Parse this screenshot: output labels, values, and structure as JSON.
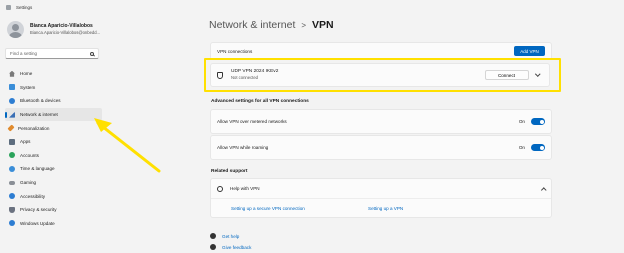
{
  "window": {
    "title": "Settings"
  },
  "user": {
    "name": "Bianca Aparicio-Villalobos",
    "email": "Bianca.Aparicio-Villalobos@onbedd..."
  },
  "search": {
    "placeholder": "Find a setting"
  },
  "nav": [
    {
      "label": "Home",
      "icon": "home-icon",
      "color": "#7a7a7a"
    },
    {
      "label": "System",
      "icon": "system-icon",
      "color": "#3b8ed8"
    },
    {
      "label": "Bluetooth & devices",
      "icon": "bluetooth-icon",
      "color": "#2d7dd2"
    },
    {
      "label": "Network & internet",
      "icon": "network-icon",
      "color": "#3a6fb5",
      "active": true
    },
    {
      "label": "Personalization",
      "icon": "brush-icon",
      "color": "#e08a2d"
    },
    {
      "label": "Apps",
      "icon": "apps-icon",
      "color": "#5d6d7e"
    },
    {
      "label": "Accounts",
      "icon": "accounts-icon",
      "color": "#2aa35b"
    },
    {
      "label": "Time & language",
      "icon": "clock-icon",
      "color": "#3b8ed8"
    },
    {
      "label": "Gaming",
      "icon": "gaming-icon",
      "color": "#8a8f96"
    },
    {
      "label": "Accessibility",
      "icon": "accessibility-icon",
      "color": "#2d7dd2"
    },
    {
      "label": "Privacy & security",
      "icon": "shield-icon",
      "color": "#6b7280"
    },
    {
      "label": "Windows Update",
      "icon": "update-icon",
      "color": "#2d7dd2"
    }
  ],
  "breadcrumb": {
    "parent": "Network & internet",
    "separator": ">",
    "current": "VPN"
  },
  "vpn_connections": {
    "label": "VPN connections",
    "add_button": "Add VPN"
  },
  "vpn_item": {
    "name": "UDP VPN 2024 IKEv2",
    "status": "Not connected",
    "connect_button": "Connect"
  },
  "advanced": {
    "title": "Advanced settings for all VPN connections",
    "metered": {
      "label": "Allow VPN over metered networks",
      "state": "On"
    },
    "roaming": {
      "label": "Allow VPN while roaming",
      "state": "On"
    }
  },
  "related": {
    "title": "Related support",
    "help_title": "Help with VPN",
    "link1": "Setting up a secure VPN connection",
    "link2": "Setting up a VPN"
  },
  "footer": {
    "get_help": "Get help",
    "give_feedback": "Give feedback"
  },
  "colors": {
    "accent": "#0067c0",
    "highlight": "#ffe000"
  }
}
